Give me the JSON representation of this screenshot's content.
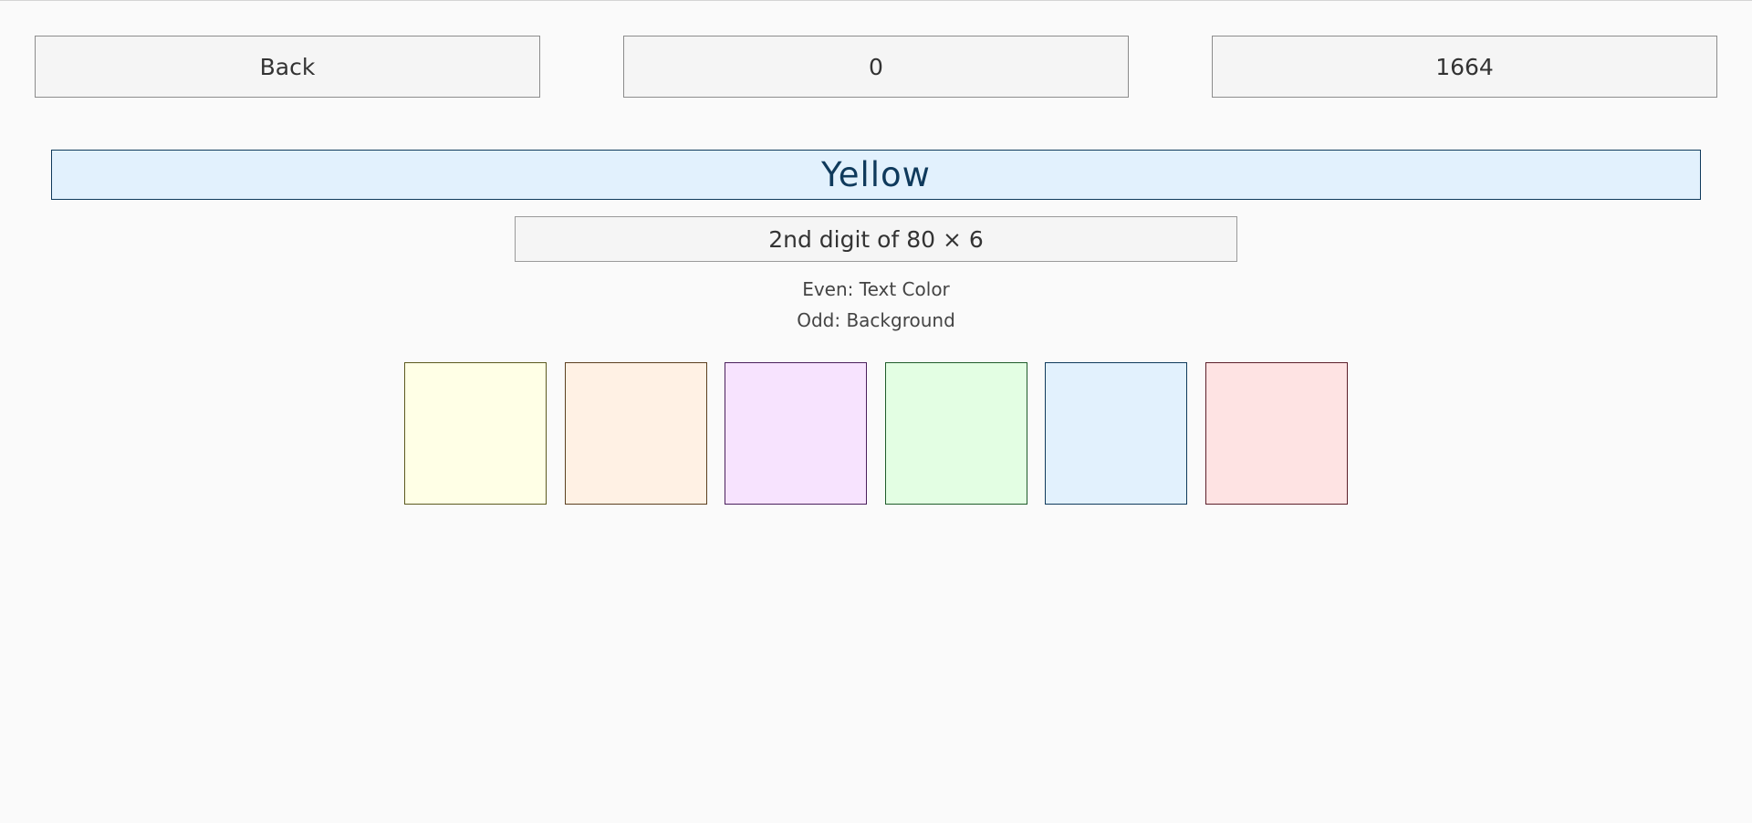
{
  "top_bar": {
    "back_label": "Back",
    "score": "0",
    "timer": "1664"
  },
  "prompt": {
    "word": "Yellow",
    "text_color": "#0f3a5c",
    "background_color": "#e2f1fd"
  },
  "question": {
    "text": "2nd digit of 80 × 6"
  },
  "rules": {
    "even": "Even: Text Color",
    "odd": "Odd: Background"
  },
  "swatches": [
    {
      "fill": "#ffffe6",
      "border": "#5c5a1f"
    },
    {
      "fill": "#fff1e4",
      "border": "#5c3f1f"
    },
    {
      "fill": "#f7e3fe",
      "border": "#4a1f5c"
    },
    {
      "fill": "#e3fee3",
      "border": "#1f5c2a"
    },
    {
      "fill": "#e2f1fd",
      "border": "#0f3a5c"
    },
    {
      "fill": "#fee3e3",
      "border": "#5c1f2a"
    }
  ]
}
